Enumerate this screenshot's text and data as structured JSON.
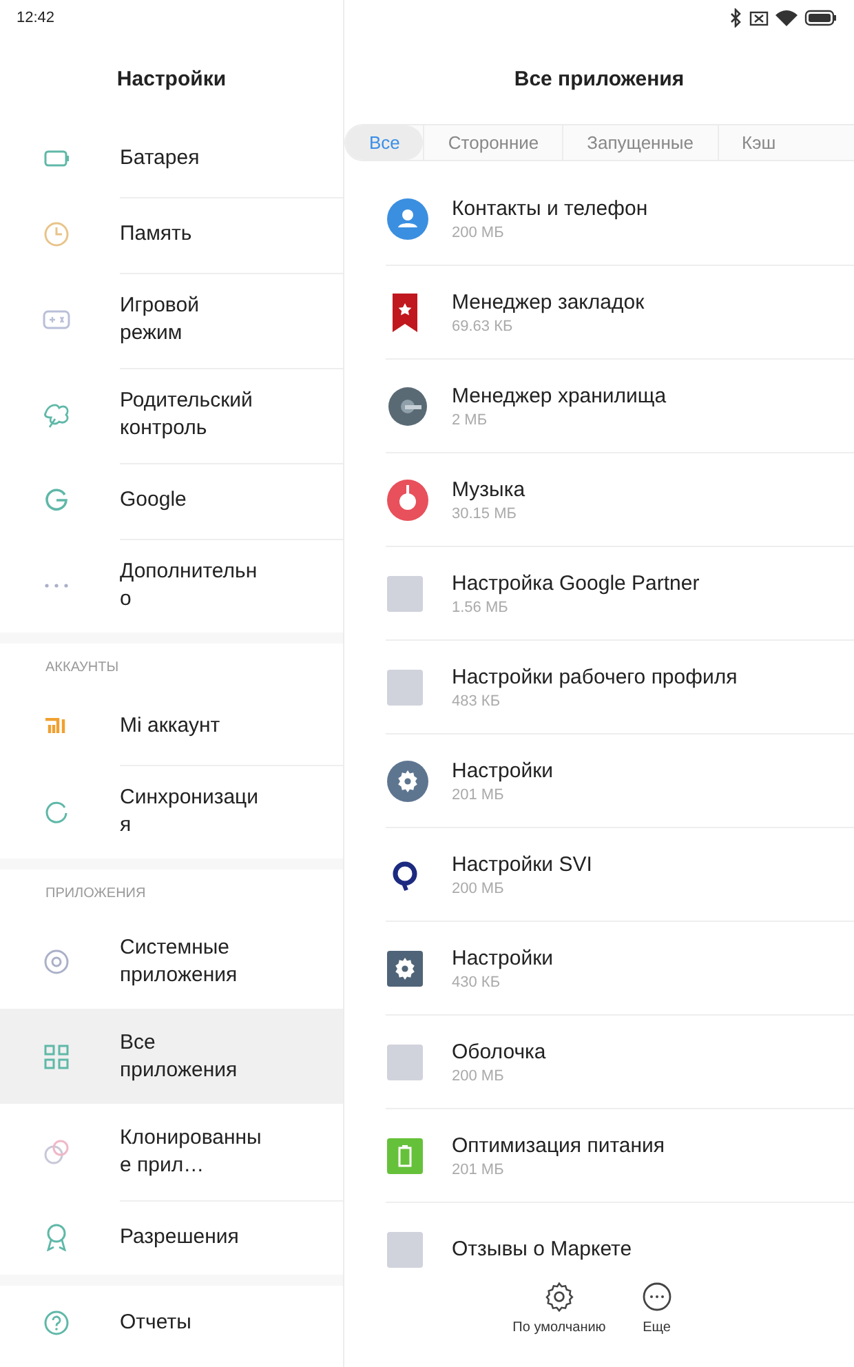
{
  "status_bar": {
    "time": "12:42"
  },
  "sidebar": {
    "title": "Настройки",
    "sections": [
      {
        "items": [
          {
            "label": "Батарея",
            "selected": false
          },
          {
            "label": "Память",
            "selected": false
          },
          {
            "label": "Игровой режим",
            "selected": false
          },
          {
            "label": "Родительский контроль",
            "selected": false
          },
          {
            "label": "Google",
            "selected": false
          },
          {
            "label": "Дополнительно",
            "selected": false
          }
        ]
      },
      {
        "title": "АККАУНТЫ",
        "items": [
          {
            "label": "Mi аккаунт",
            "selected": false
          },
          {
            "label": "Синхронизация",
            "selected": false
          }
        ]
      },
      {
        "title": "ПРИЛОЖЕНИЯ",
        "items": [
          {
            "label": "Системные приложения",
            "selected": false
          },
          {
            "label": "Все приложения",
            "selected": true
          },
          {
            "label": "Клонированные прил…",
            "selected": false
          },
          {
            "label": "Разрешения",
            "selected": false
          }
        ]
      },
      {
        "items": [
          {
            "label": "Отчеты",
            "selected": false
          }
        ]
      }
    ]
  },
  "main": {
    "title": "Все приложения",
    "tabs": [
      {
        "label": "Все",
        "selected": true
      },
      {
        "label": "Сторонние",
        "selected": false
      },
      {
        "label": "Запущенные",
        "selected": false
      },
      {
        "label": "Кэш",
        "selected": false
      }
    ],
    "apps": [
      {
        "name": "Контакты и телефон",
        "size": "200 МБ"
      },
      {
        "name": "Менеджер закладок",
        "size": "69.63 КБ"
      },
      {
        "name": "Менеджер хранилища",
        "size": "2 МБ"
      },
      {
        "name": "Музыка",
        "size": "30.15 МБ"
      },
      {
        "name": "Настройка Google Partner",
        "size": "1.56 МБ"
      },
      {
        "name": "Настройки рабочего профиля",
        "size": "483 КБ"
      },
      {
        "name": "Настройки",
        "size": "201 МБ"
      },
      {
        "name": "Настройки SVI",
        "size": "200 МБ"
      },
      {
        "name": "Настройки",
        "size": "430 КБ"
      },
      {
        "name": "Оболочка",
        "size": "200 МБ"
      },
      {
        "name": "Оптимизация питания",
        "size": "201 МБ"
      },
      {
        "name": "Отзывы о Маркете"
      }
    ],
    "bottom_bar": [
      {
        "label": "По умолчанию"
      },
      {
        "label": "Еще"
      }
    ]
  }
}
